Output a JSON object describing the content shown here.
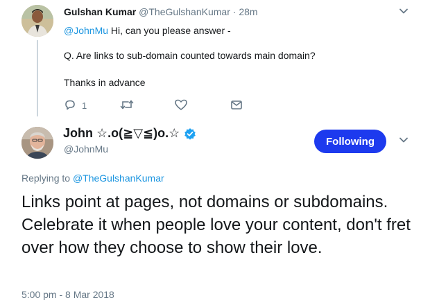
{
  "parent_tweet": {
    "author_name": "Gulshan Kumar",
    "author_handle": "@TheGulshanKumar",
    "separator": "·",
    "time": "28m",
    "mention": "@JohnMu",
    "greeting": " Hi, can you please answer -",
    "question": "Q. Are links to sub-domain counted towards main domain?",
    "closing": "Thanks in advance",
    "reply_count": "1",
    "icons": [
      "reply-icon",
      "retweet-icon",
      "like-icon",
      "direct-message-icon",
      "chevron-down-icon"
    ]
  },
  "main_tweet": {
    "author_name": "John ☆.o(≧▽≦)o.☆",
    "author_handle": "@JohnMu",
    "follow_label": "Following",
    "replying_prefix": "Replying to ",
    "replying_mention": "@TheGulshanKumar",
    "text": "Links point at pages, not domains or subdomains. Celebrate it when people love your content, don't fret over how they choose to show their love.",
    "timestamp": "5:00 pm - 8 Mar 2018",
    "icons": [
      "verified-badge-icon",
      "chevron-down-icon"
    ]
  },
  "colors": {
    "link": "#1b95e0",
    "button": "#1d3aee",
    "muted": "#657786",
    "thread_line": "#ccd6dd"
  }
}
